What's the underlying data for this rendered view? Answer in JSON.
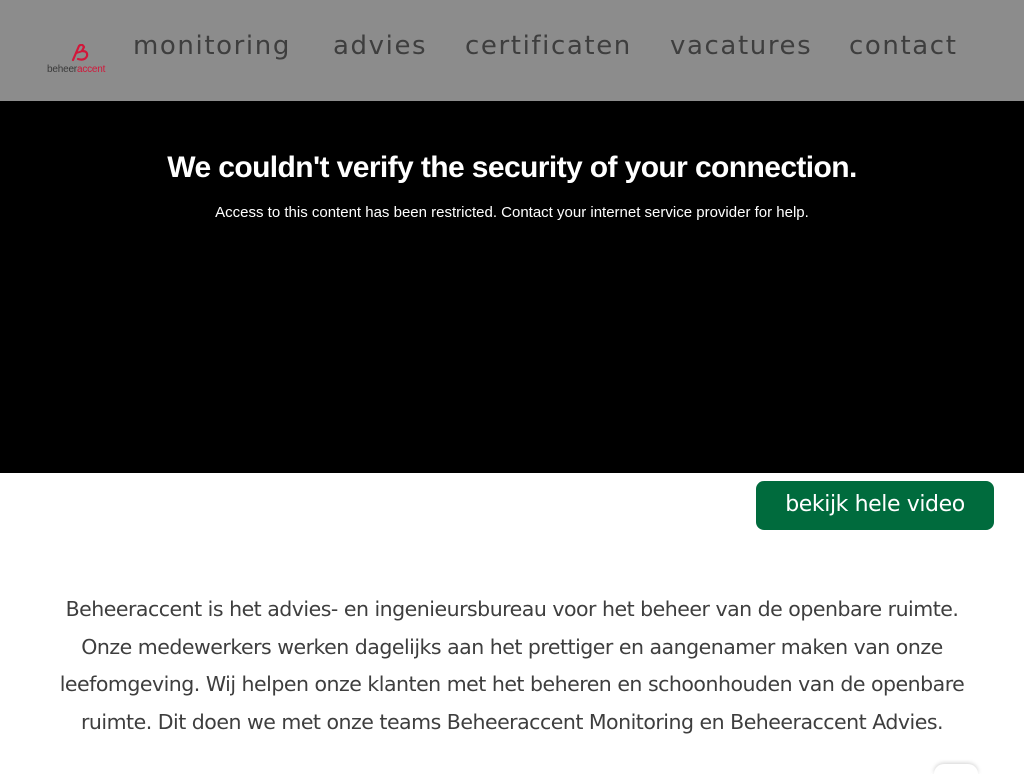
{
  "brand": {
    "name_part1": "beheer",
    "name_part2": "accent",
    "color": "#d2173a"
  },
  "nav": {
    "items": [
      {
        "label": "monitoring"
      },
      {
        "label": "advies"
      },
      {
        "label": "certificaten"
      },
      {
        "label": "vacatures"
      },
      {
        "label": "contact"
      }
    ]
  },
  "video": {
    "error_title": "We couldn't verify the security of your connection.",
    "error_message": "Access to this content has been restricted. Contact your internet service provider for help.",
    "button_label": "bekijk hele video",
    "button_color": "#006b3d"
  },
  "intro": {
    "text": "Beheeraccent is het advies- en ingenieursbureau voor het beheer van de openbare ruimte. Onze medewerkers werken dagelijks aan het prettiger en aangenamer maken van onze leefomgeving. Wij helpen onze klanten met het beheren en schoonhouden van de openbare ruimte. Dit doen we met onze teams Beheeraccent Monitoring en Beheeraccent Advies."
  }
}
